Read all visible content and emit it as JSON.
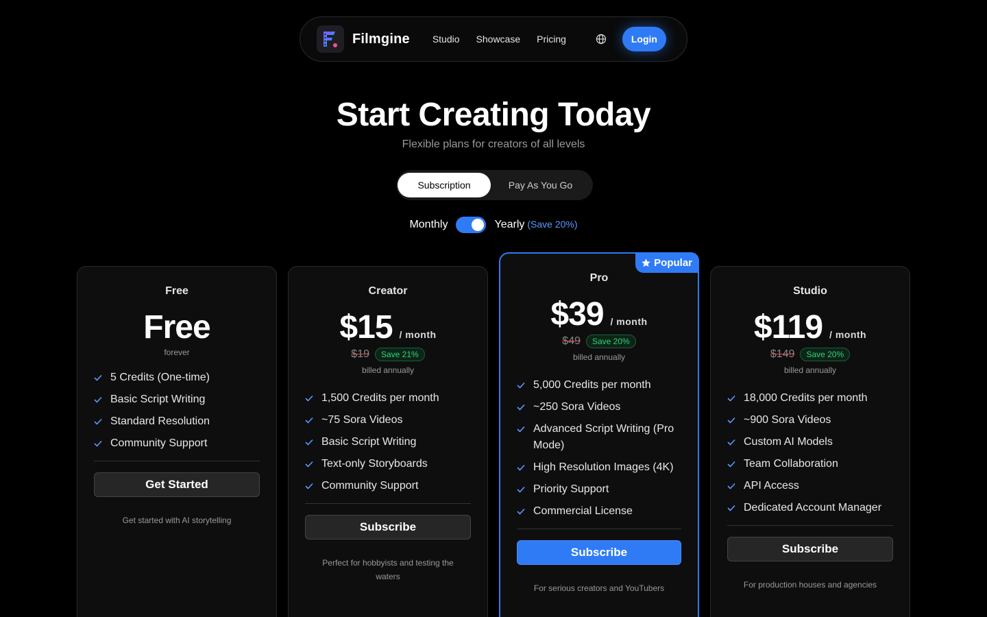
{
  "nav": {
    "brand": "Filmgine",
    "links": [
      "Studio",
      "Showcase",
      "Pricing"
    ],
    "login": "Login"
  },
  "hero": {
    "title": "Start Creating Today",
    "subtitle": "Flexible plans for creators of all levels"
  },
  "mode": {
    "subscription": "Subscription",
    "payg": "Pay As You Go"
  },
  "billing": {
    "monthly": "Monthly",
    "yearly": "Yearly",
    "yearly_save": "(Save 20%)"
  },
  "colors": {
    "accent": "#2f7bf5",
    "save_green": "#34d27b",
    "strike_red": "#e5484d"
  },
  "plans": [
    {
      "name": "Free",
      "price": "Free",
      "price_note": "forever",
      "features": [
        "5 Credits (One-time)",
        "Basic Script Writing",
        "Standard Resolution",
        "Community Support"
      ],
      "button": "Get Started",
      "description": "Get started with AI storytelling"
    },
    {
      "name": "Creator",
      "price": "$15",
      "per": "/ month",
      "original": "$19",
      "save": "Save 21%",
      "billed": "billed annually",
      "features": [
        "1,500 Credits per month",
        "~75 Sora Videos",
        "Basic Script Writing",
        "Text-only Storyboards",
        "Community Support"
      ],
      "button": "Subscribe",
      "description": "Perfect for hobbyists and testing the waters"
    },
    {
      "name": "Pro",
      "badge": "Popular",
      "price": "$39",
      "per": "/ month",
      "original": "$49",
      "save": "Save 20%",
      "billed": "billed annually",
      "features": [
        "5,000 Credits per month",
        "~250 Sora Videos",
        "Advanced Script Writing (Pro Mode)",
        "High Resolution Images (4K)",
        "Priority Support",
        "Commercial License"
      ],
      "button": "Subscribe",
      "description": "For serious creators and YouTubers"
    },
    {
      "name": "Studio",
      "price": "$119",
      "per": "/ month",
      "original": "$149",
      "save": "Save 20%",
      "billed": "billed annually",
      "features": [
        "18,000 Credits per month",
        "~900 Sora Videos",
        "Custom AI Models",
        "Team Collaboration",
        "API Access",
        "Dedicated Account Manager"
      ],
      "button": "Subscribe",
      "description": "For production houses and agencies"
    }
  ]
}
